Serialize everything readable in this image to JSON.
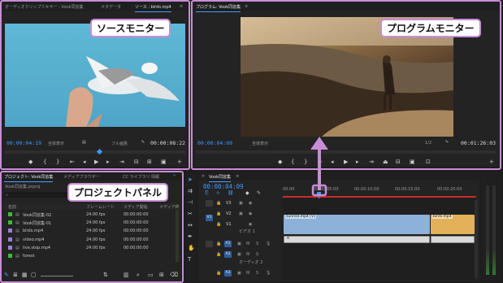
{
  "source_panel": {
    "tabs": [
      "オーディオクリップミキサー : Vook同窓集",
      "メタデータ",
      "ソース : birds.mp4"
    ],
    "timecode_in": "00:00:04:19",
    "zoom": "全体表示",
    "quality": "フル画質",
    "duration": "00:00:08:22"
  },
  "program_panel": {
    "tab": "プログラム: Vook同窓集",
    "timecode_in": "00:00:04:09",
    "zoom": "全体表示",
    "quality": "1/2",
    "duration": "00:01:26:03"
  },
  "project_panel": {
    "tabs": [
      "プロジェクト: Vook同窓集",
      "メディアブラウザー",
      "CC ライブラリ",
      "情報"
    ],
    "filename": "Vook同窓集.prproj",
    "columns": [
      "名前",
      "フレームレート",
      "メディア開始",
      "メディア終"
    ],
    "items": [
      {
        "name": "Vook同窓集-02",
        "fps": "24.00 fps",
        "start": "00:00:00:00",
        "color": "#3fb83a"
      },
      {
        "name": "Vook同窓集-01",
        "fps": "24.00 fps",
        "start": "00:00:00:00",
        "color": "#3fb83a"
      },
      {
        "name": "birds.mp4",
        "fps": "24.00 fps",
        "start": "00:00:00:00",
        "color": "#9b7fd6"
      },
      {
        "name": "video.mp4",
        "fps": "24.00 fps",
        "start": "00:00:00:00",
        "color": "#9b7fd6"
      },
      {
        "name": "live.stop.mp4",
        "fps": "24.00 fps",
        "start": "00:00:00:00",
        "color": "#9b7fd6"
      },
      {
        "name": "forest",
        "fps": "",
        "start": "",
        "color": "#3fb83a"
      }
    ]
  },
  "timeline": {
    "tab": "Vook同窓集",
    "timecode": "00:00:04:09",
    "ruler_ticks": [
      "00:00",
      "00:00:05:00",
      "00:00:10:00",
      "00:00:15:00",
      "00:00:20:00"
    ],
    "tracks": {
      "video": [
        "V3",
        "V2",
        "V1"
      ],
      "audio": [
        "A1",
        "A2",
        "A3"
      ],
      "v1_name": "ビデオ 1",
      "a2_name": "オーディオ 2"
    },
    "clips": {
      "v1_main": "sunrise.mp4 [V]",
      "v1_end": "birds.mp4",
      "a1_main": "A"
    }
  },
  "callouts": {
    "source": "ソースモニター",
    "program": "プログラムモニター",
    "project": "プロジェクトパネル"
  }
}
